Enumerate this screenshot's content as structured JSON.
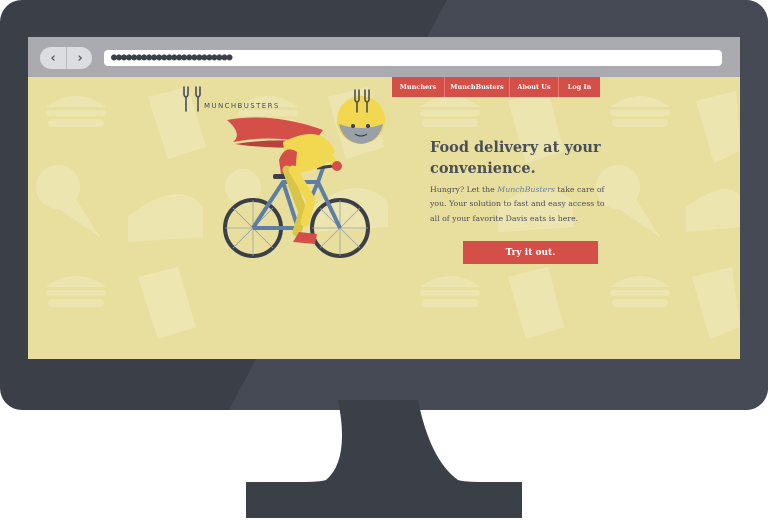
{
  "browser": {
    "back_icon": "‹",
    "forward_icon": "›",
    "url": "●●●●●●●●●●●●●●●●●●●●●●●●"
  },
  "site": {
    "logo_text": "MUNCHBUSTERS",
    "nav": [
      "Munchers",
      "MunchBusters",
      "About Us",
      "Log In"
    ],
    "hero": {
      "title": "Food delivery at your convenience.",
      "text_before": "Hungry? Let the ",
      "text_brand": "MunchBusters",
      "text_after": " take care of you. Your solution to fast and easy access to all of your favorite Davis eats is here.",
      "cta": "Try it out."
    }
  },
  "colors": {
    "monitor": "#3b3f48",
    "background": "#e8df9f",
    "accent": "#d34f48",
    "text": "#4a4f57",
    "link": "#5e7fa3"
  }
}
